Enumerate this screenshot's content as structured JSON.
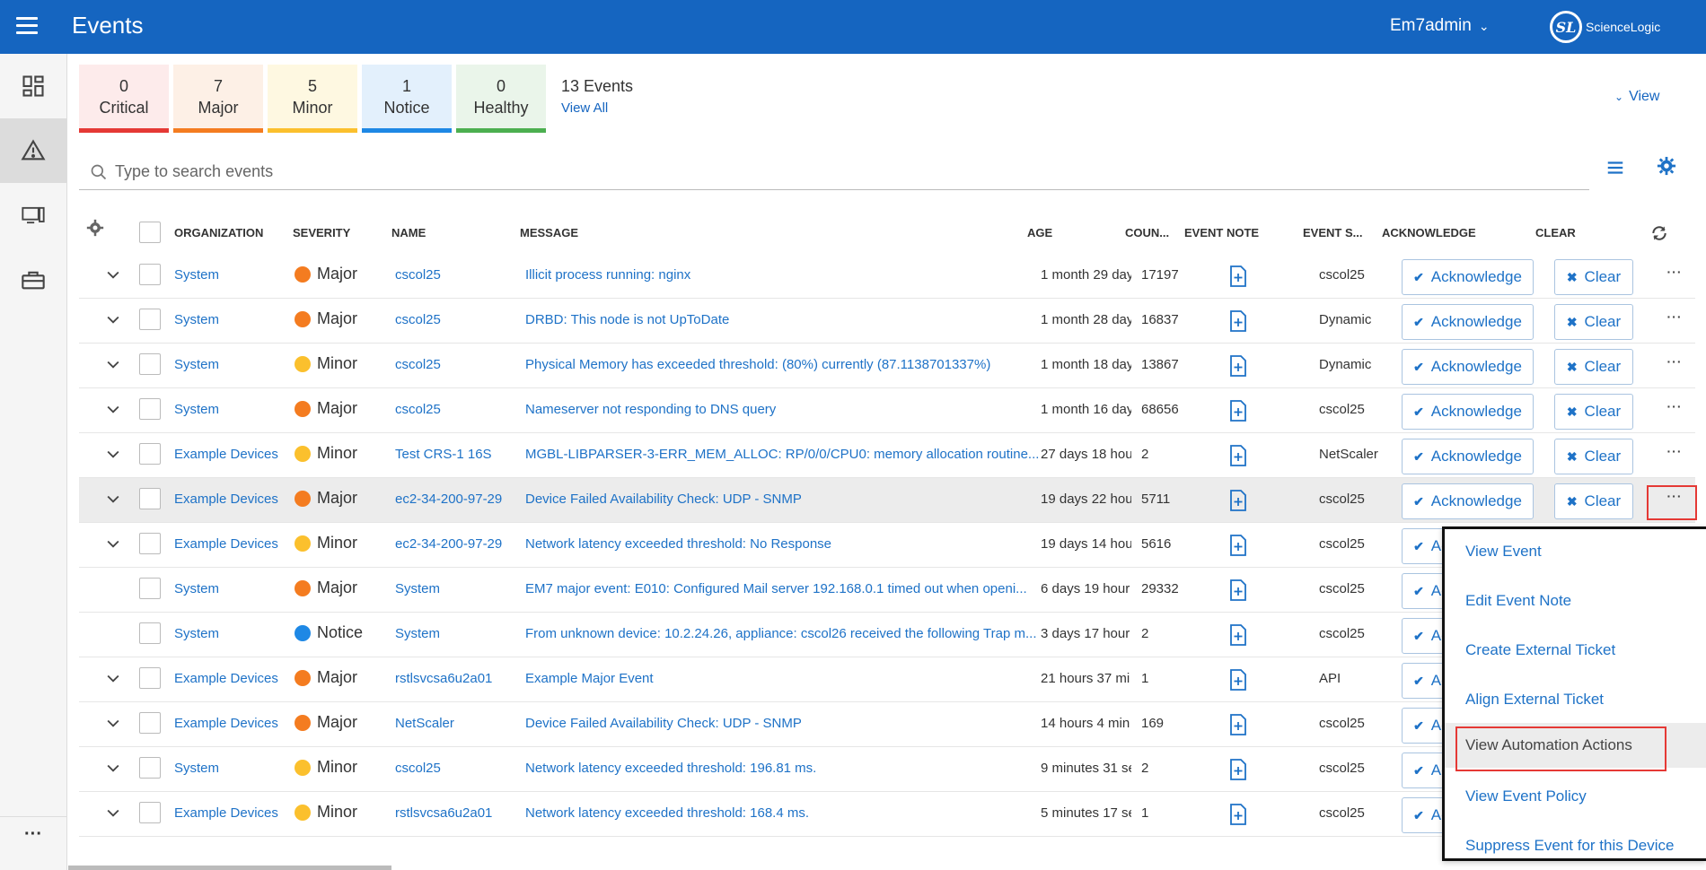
{
  "header": {
    "title": "Events",
    "user": "Em7admin",
    "logo_text": "ScienceLogic",
    "logo_mark": "SL"
  },
  "colors": {
    "brand": "#1565c0",
    "critical": "#e53935",
    "major": "#f47c20",
    "minor": "#fbc02d",
    "notice": "#1e88e5",
    "healthy": "#4caf50"
  },
  "summary": {
    "tiles": [
      {
        "count": "0",
        "label": "Critical"
      },
      {
        "count": "7",
        "label": "Major"
      },
      {
        "count": "5",
        "label": "Minor"
      },
      {
        "count": "1",
        "label": "Notice"
      },
      {
        "count": "0",
        "label": "Healthy"
      }
    ],
    "events_count": "13 Events",
    "view_all": "View All",
    "view_toggle": "View"
  },
  "search": {
    "placeholder": "Type to search events"
  },
  "table": {
    "headers": {
      "organization": "ORGANIZATION",
      "severity": "SEVERITY",
      "name": "NAME",
      "message": "MESSAGE",
      "age": "AGE",
      "count": "COUN...",
      "event_note": "EVENT NOTE",
      "event_source": "EVENT S...",
      "acknowledge": "ACKNOWLEDGE",
      "clear": "CLEAR"
    },
    "ack_label": "Acknowledge",
    "clear_label": "Clear",
    "more_label": "···",
    "rows": [
      {
        "org": "System",
        "severity": "Major",
        "sev_color": "#f47c20",
        "name": "cscol25",
        "message": "Illicit process running: nginx",
        "age": "1 month 29 day",
        "count": "17197",
        "source": "cscol25",
        "expandable": true
      },
      {
        "org": "System",
        "severity": "Major",
        "sev_color": "#f47c20",
        "name": "cscol25",
        "message": "DRBD: This node is not UpToDate",
        "age": "1 month 28 day",
        "count": "16837",
        "source": "Dynamic",
        "expandable": true
      },
      {
        "org": "System",
        "severity": "Minor",
        "sev_color": "#fbc02d",
        "name": "cscol25",
        "message": "Physical Memory has exceeded threshold: (80%) currently (87.1138701337%)",
        "age": "1 month 18 day",
        "count": "13867",
        "source": "Dynamic",
        "expandable": true
      },
      {
        "org": "System",
        "severity": "Major",
        "sev_color": "#f47c20",
        "name": "cscol25",
        "message": "Nameserver not responding to DNS query",
        "age": "1 month 16 day",
        "count": "68656",
        "source": "cscol25",
        "expandable": true
      },
      {
        "org": "Example Devices",
        "severity": "Minor",
        "sev_color": "#fbc02d",
        "name": "Test CRS-1 16S",
        "message": "MGBL-LIBPARSER-3-ERR_MEM_ALLOC: RP/0/0/CPU0: memory allocation routine...",
        "age": "27 days 18 hou",
        "count": "2",
        "source": "NetScaler",
        "expandable": true
      },
      {
        "org": "Example Devices",
        "severity": "Major",
        "sev_color": "#f47c20",
        "name": "ec2-34-200-97-29",
        "message": "Device Failed Availability Check: UDP - SNMP",
        "age": "19 days 22 hou",
        "count": "5711",
        "source": "cscol25",
        "expandable": true,
        "highlight": true
      },
      {
        "org": "Example Devices",
        "severity": "Minor",
        "sev_color": "#fbc02d",
        "name": "ec2-34-200-97-29",
        "message": "Network latency exceeded threshold: No Response",
        "age": "19 days 14 hou",
        "count": "5616",
        "source": "cscol25",
        "expandable": true
      },
      {
        "org": "System",
        "severity": "Major",
        "sev_color": "#f47c20",
        "name": "System",
        "message": "EM7 major event: E010: Configured Mail server 192.168.0.1 timed out when openi...",
        "age": "6 days 19 hour",
        "count": "29332",
        "source": "cscol25",
        "expandable": false
      },
      {
        "org": "System",
        "severity": "Notice",
        "sev_color": "#1e88e5",
        "name": "System",
        "message": "From unknown device: 10.2.24.26, appliance: cscol26 received the following Trap m...",
        "age": "3 days 17 hour",
        "count": "2",
        "source": "cscol25",
        "expandable": false
      },
      {
        "org": "Example Devices",
        "severity": "Major",
        "sev_color": "#f47c20",
        "name": "rstlsvcsa6u2a01",
        "message": "Example Major Event",
        "age": "21 hours 37 mi",
        "count": "1",
        "source": "API",
        "expandable": true
      },
      {
        "org": "Example Devices",
        "severity": "Major",
        "sev_color": "#f47c20",
        "name": "NetScaler",
        "message": "Device Failed Availability Check: UDP - SNMP",
        "age": "14 hours 4 min",
        "count": "169",
        "source": "cscol25",
        "expandable": true
      },
      {
        "org": "System",
        "severity": "Minor",
        "sev_color": "#fbc02d",
        "name": "cscol25",
        "message": "Network latency exceeded threshold: 196.81 ms.",
        "age": "9 minutes 31 se",
        "count": "2",
        "source": "cscol25",
        "expandable": true
      },
      {
        "org": "Example Devices",
        "severity": "Minor",
        "sev_color": "#fbc02d",
        "name": "rstlsvcsa6u2a01",
        "message": "Network latency exceeded threshold: 168.4 ms.",
        "age": "5 minutes 17 se",
        "count": "1",
        "source": "cscol25",
        "expandable": true
      }
    ]
  },
  "context_menu": {
    "items": [
      "View Event",
      "Edit Event Note",
      "Create External Ticket",
      "Align External Ticket",
      "View Automation Actions",
      "View Event Policy",
      "Suppress Event for this Device"
    ],
    "hover_index": 4
  },
  "left_rail": {
    "items": [
      "dashboard-icon",
      "events-icon",
      "devices-icon",
      "toolbox-icon"
    ],
    "active": "events-icon",
    "more": "···"
  }
}
